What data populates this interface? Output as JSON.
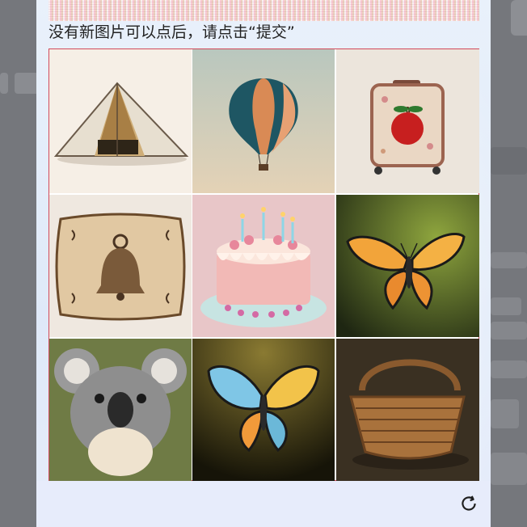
{
  "captcha": {
    "instruction": "没有新图片可以点后，请点击“提交”",
    "tiles": [
      {
        "name": "tent",
        "icon": "tent-icon"
      },
      {
        "name": "hot-air-balloon",
        "icon": "hot-air-balloon-icon"
      },
      {
        "name": "suitcase-with-apple",
        "icon": "suitcase-icon"
      },
      {
        "name": "pillow-with-bell",
        "icon": "pillow-icon"
      },
      {
        "name": "birthday-cake",
        "icon": "cake-icon"
      },
      {
        "name": "butterfly-orange",
        "icon": "butterfly-icon"
      },
      {
        "name": "koala",
        "icon": "koala-icon"
      },
      {
        "name": "butterfly-colorful",
        "icon": "butterfly-icon"
      },
      {
        "name": "wicker-basket",
        "icon": "basket-icon"
      }
    ],
    "refresh_icon": "refresh-icon",
    "colors": {
      "grid_border": "#d24a5a",
      "modal_bg": "#e9f1fb"
    }
  }
}
